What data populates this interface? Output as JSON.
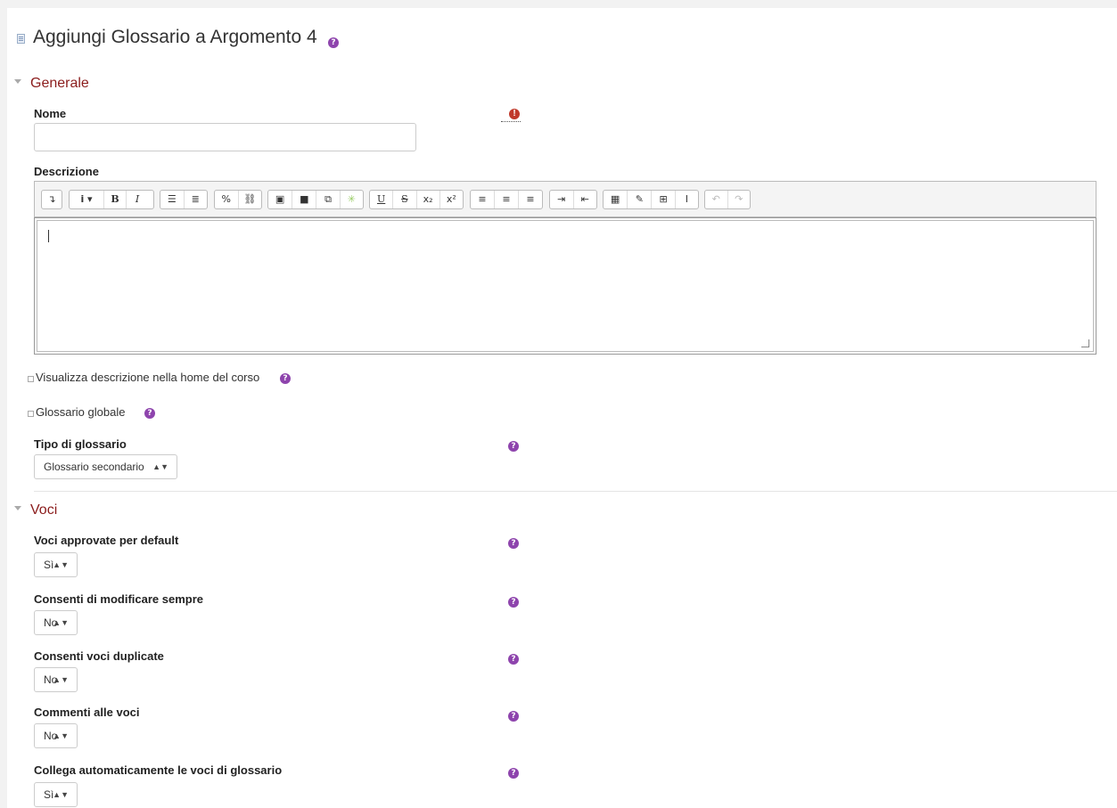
{
  "page": {
    "title": "Aggiungi Glossario a Argomento 4"
  },
  "sections": {
    "generale": "Generale",
    "voci": "Voci"
  },
  "fields": {
    "nome_label": "Nome",
    "descrizione_label": "Descrizione",
    "show_description": "Visualizza descrizione nella home del corso",
    "global_glossary": "Glossario globale",
    "type_label": "Tipo di glossario",
    "type_value": "Glossario secondario",
    "approved_label": "Voci approvate per default",
    "approved_value": "Sì",
    "always_edit_label": "Consenti di modificare sempre",
    "always_edit_value": "No",
    "duplicates_label": "Consenti voci duplicate",
    "duplicates_value": "No",
    "comments_label": "Commenti alle voci",
    "comments_value": "No",
    "autolink_label": "Collega automaticamente le voci di glossario",
    "autolink_value": "Sì"
  },
  "icons": {
    "help": "question-circle-icon",
    "required": "exclamation-circle-icon",
    "page": "page-icon"
  },
  "colors": {
    "section_heading": "#8b1c1c",
    "help_icon": "#8e44ad",
    "required_icon": "#c0392b"
  }
}
